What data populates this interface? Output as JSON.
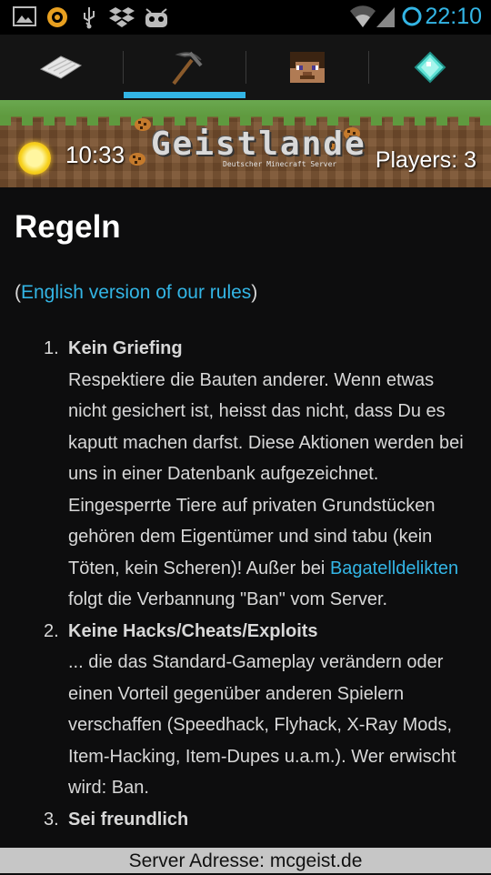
{
  "status_bar": {
    "time": "22:10",
    "icons": [
      "gallery-icon",
      "browser-icon",
      "usb-icon",
      "dropbox-icon",
      "android-face-icon",
      "wifi-icon",
      "signal-icon",
      "sync-ring-icon"
    ]
  },
  "tabs": [
    {
      "icon": "paper-map-icon",
      "selected": false
    },
    {
      "icon": "pickaxe-icon",
      "selected": true
    },
    {
      "icon": "steve-head-icon",
      "selected": false
    },
    {
      "icon": "diamond-icon",
      "selected": false
    }
  ],
  "banner": {
    "time": "10:33",
    "logo": "Geistlande",
    "logo_sub": "Deutscher Minecraft Server",
    "players": "Players: 3"
  },
  "page": {
    "title": "Regeln",
    "lang_open": "(",
    "lang_link": "English version of our rules",
    "lang_close": ")"
  },
  "rules": [
    {
      "num": "1.",
      "title": "Kein Griefing",
      "text_before": "Respektiere die Bauten anderer. Wenn etwas nicht gesichert ist, heisst das nicht, dass Du es kaputt machen darfst. Diese Aktionen werden bei uns in einer Datenbank aufgezeichnet. Eingesperrte Tiere auf privaten Grundstücken gehören dem Eigentümer und sind tabu (kein Töten, kein Scheren)! Außer bei ",
      "link": "Bagatelldelikten",
      "text_after": " folgt die Verbannung \"Ban\" vom Server."
    },
    {
      "num": "2.",
      "title": "Keine Hacks/Cheats/Exploits",
      "text_before": "... die das Standard-Gameplay verändern oder einen Vorteil gegenüber anderen Spielern verschaffen (Speedhack, Flyhack, X-Ray Mods, Item-Hacking, Item-Dupes u.a.m.). Wer erwischt wird: Ban.",
      "link": "",
      "text_after": ""
    },
    {
      "num": "3.",
      "title": "Sei freundlich",
      "text_before": "",
      "link": "",
      "text_after": ""
    }
  ],
  "footer": {
    "text": "Server Adresse: mcgeist.de"
  },
  "colors": {
    "accent": "#33b5e5",
    "background": "#0d0d0e",
    "footer_bg": "#c6c6c6"
  }
}
